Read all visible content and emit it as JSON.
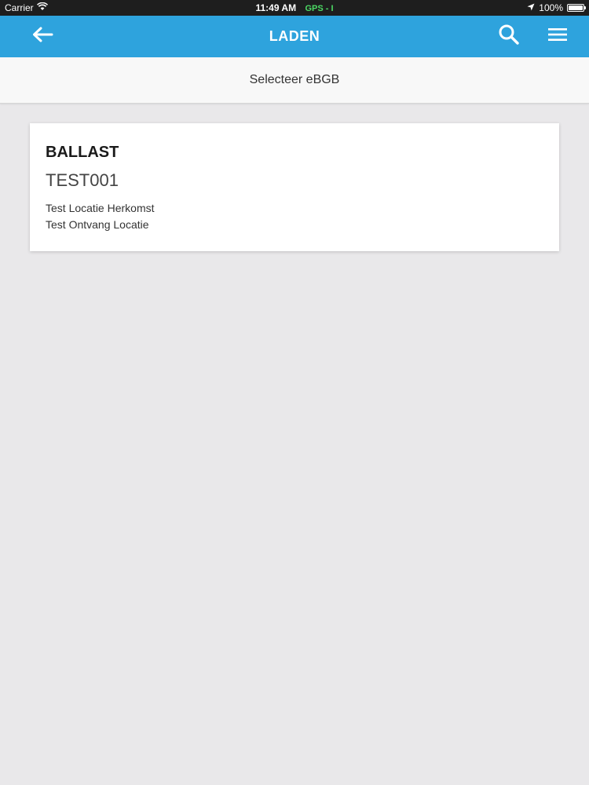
{
  "status_bar": {
    "carrier": "Carrier",
    "time": "11:49 AM",
    "gps": "GPS - I",
    "battery": "100%",
    "battery_level": 1.0
  },
  "app_bar": {
    "title": "LADEN",
    "back_icon": "arrow-left-icon",
    "search_icon": "search-icon",
    "menu_icon": "hamburger-menu-icon",
    "background_color": "#2ea3dd"
  },
  "sub_header": {
    "title": "Selecteer eBGB"
  },
  "items": [
    {
      "title": "BALLAST",
      "code": "TEST001",
      "origin": "Test Locatie Herkomst",
      "destination": "Test Ontvang Locatie"
    }
  ]
}
